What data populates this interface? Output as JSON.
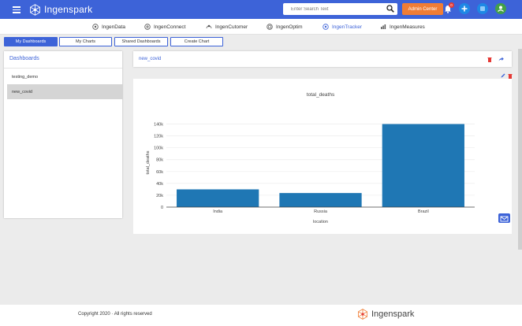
{
  "app": {
    "brand": "Ingenspark"
  },
  "header": {
    "search_placeholder": "Enter Search Text",
    "admin_label": "Admin Center",
    "notification_count": "0"
  },
  "nav": {
    "items": [
      {
        "label": "IngenData"
      },
      {
        "label": "IngenConnect"
      },
      {
        "label": "IngenCutomer"
      },
      {
        "label": "IngenOptim"
      },
      {
        "label": "IngenTracker",
        "active": true
      },
      {
        "label": "IngenMeasures"
      }
    ]
  },
  "tabs": [
    {
      "label": "My Dashboards",
      "active": true
    },
    {
      "label": "My Charts"
    },
    {
      "label": "Shared Dashboards"
    },
    {
      "label": "Create Chart"
    }
  ],
  "sidebar": {
    "title": "Dashboards",
    "items": [
      {
        "label": "testing_demo"
      },
      {
        "label": "new_covid",
        "active": true
      }
    ]
  },
  "dashboard": {
    "title": "new_covid"
  },
  "chart_data": {
    "type": "bar",
    "title": "total_deaths",
    "xlabel": "location",
    "ylabel": "total_deaths",
    "categories": [
      "India",
      "Russia",
      "Brazil"
    ],
    "values": [
      29900,
      23700,
      140000
    ],
    "ylim": [
      0,
      150000
    ],
    "yticks": [
      0,
      20000,
      40000,
      60000,
      80000,
      100000,
      120000,
      140000
    ],
    "ytick_labels": [
      "0",
      "20k",
      "40k",
      "60k",
      "80k",
      "100k",
      "120k",
      "140k"
    ],
    "grid": true,
    "bar_color": "#1f77b4"
  },
  "footer": {
    "copyright": "Copyright 2020 · All rights reserved"
  },
  "colors": {
    "primary": "#3d63d8",
    "accent": "#f07d35",
    "danger": "#e53935",
    "green": "#43a047"
  }
}
